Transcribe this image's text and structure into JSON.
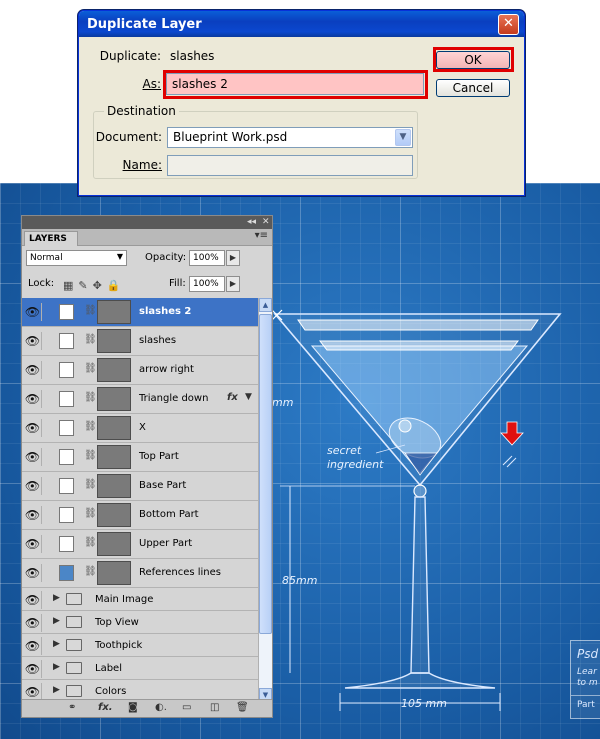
{
  "dialog": {
    "title": "Duplicate Layer",
    "duplicate_label": "Duplicate:",
    "duplicate_value": "slashes",
    "as_label": "As:",
    "as_value": "slashes 2",
    "ok_label": "OK",
    "cancel_label": "Cancel",
    "destination_legend": "Destination",
    "document_label": "Document:",
    "document_value": "Blueprint Work.psd",
    "name_label": "Name:",
    "name_value": ""
  },
  "layers_panel": {
    "tab": "LAYERS",
    "blend_mode": "Normal",
    "opacity_label": "Opacity:",
    "opacity_value": "100%",
    "lock_label": "Lock:",
    "fill_label": "Fill:",
    "fill_value": "100%",
    "layers": [
      {
        "name": "slashes 2",
        "selected": true,
        "fx": false,
        "mask_color": "#ffffff"
      },
      {
        "name": "slashes",
        "selected": false,
        "fx": false,
        "mask_color": "#ffffff"
      },
      {
        "name": "arrow right",
        "selected": false,
        "fx": false,
        "mask_color": "#ffffff"
      },
      {
        "name": "Triangle down",
        "selected": false,
        "fx": true,
        "mask_color": "#ffffff"
      },
      {
        "name": "X",
        "selected": false,
        "fx": false,
        "mask_color": "#ffffff"
      },
      {
        "name": "Top Part",
        "selected": false,
        "fx": false,
        "mask_color": "#ffffff"
      },
      {
        "name": "Base Part",
        "selected": false,
        "fx": false,
        "mask_color": "#ffffff"
      },
      {
        "name": "Bottom Part",
        "selected": false,
        "fx": false,
        "mask_color": "#ffffff"
      },
      {
        "name": "Upper Part",
        "selected": false,
        "fx": false,
        "mask_color": "#ffffff"
      },
      {
        "name": "References lines",
        "selected": false,
        "fx": false,
        "mask_color": "#4b86c7"
      }
    ],
    "groups": [
      "Main Image",
      "Top View",
      "Toothpick",
      "Label",
      "Colors"
    ],
    "fx_label": "fx",
    "bottom_icons": [
      "link-icon",
      "fx-icon",
      "mask-icon",
      "adjustment-icon",
      "new-group-icon",
      "new-layer-icon",
      "trash-icon"
    ]
  },
  "canvas": {
    "dimension_top": "mm",
    "dimension_side": "85mm",
    "dimension_bottom": "105 mm",
    "annotation_line1": "secret",
    "annotation_line2": "ingredient",
    "side_box_title": "Psd",
    "side_box_line1": "Lear",
    "side_box_line2": "to m",
    "side_box_footer": "Part",
    "marker_color": "#e01010",
    "highlight_color": "#e00000",
    "blueprint_color": "#1b5fa6"
  }
}
